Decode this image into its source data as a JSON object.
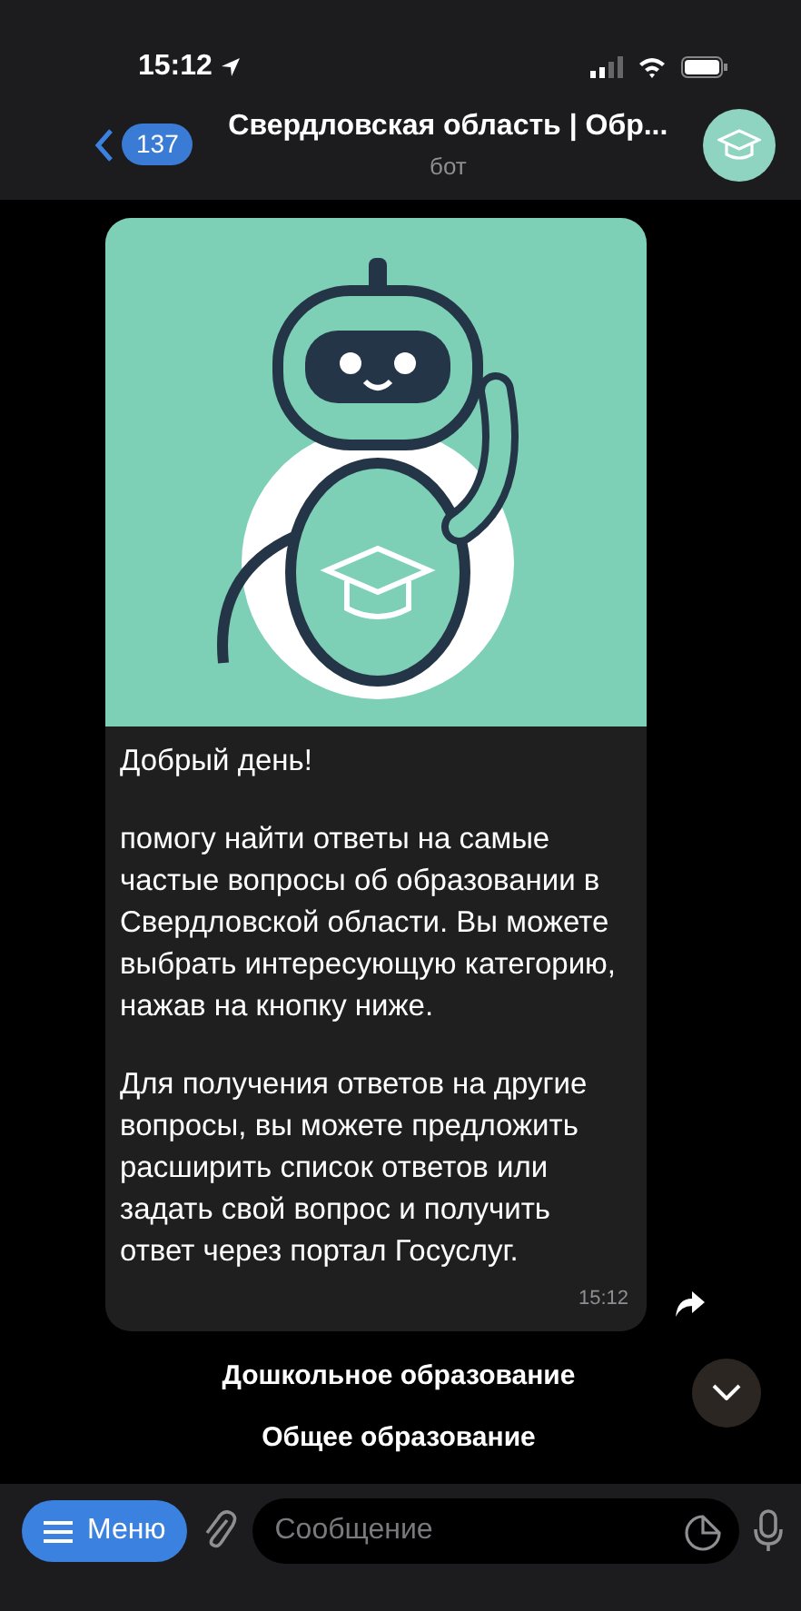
{
  "status_bar": {
    "time": "15:12"
  },
  "header": {
    "unread_count": "137",
    "title": "Свердловская область | Обр...",
    "subtitle": "бот"
  },
  "message": {
    "paragraphs": [
      "Добрый день!",
      "помогу найти ответы на самые частые вопросы об образовании в Свердловской области. Вы можете выбрать интересующую категорию, нажав на кнопку ниже.",
      "Для получения ответов на другие вопросы, вы можете предложить расширить список ответов или задать свой вопрос и получить ответ через портал Госуслуг."
    ],
    "time": "15:12"
  },
  "keyboard": [
    "Дошкольное образование",
    "Общее образование"
  ],
  "input_bar": {
    "menu_label": "Меню",
    "placeholder": "Сообщение"
  }
}
